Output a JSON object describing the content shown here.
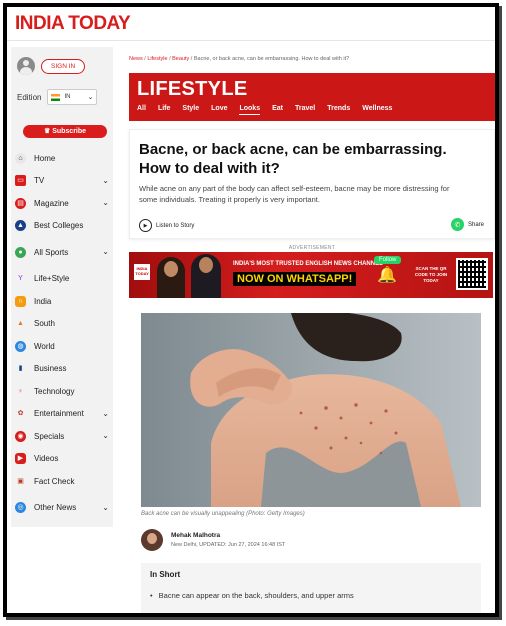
{
  "brand": {
    "logo": "INDIA TODAY",
    "accent": "#d91c1c"
  },
  "sidebar": {
    "signin_label": "SIGN IN",
    "edition_label": "Edition",
    "edition_value": "IN",
    "subscribe_label": "Subscribe",
    "items": [
      {
        "label": "Home",
        "icon": "home-icon",
        "chevron": false
      },
      {
        "label": "TV",
        "icon": "tv-icon",
        "chevron": true
      },
      {
        "label": "Magazine",
        "icon": "magazine-icon",
        "chevron": true
      },
      {
        "label": "Best Colleges",
        "icon": "graduation-cap-icon",
        "chevron": false
      },
      {
        "label": "All Sports",
        "icon": "sports-icon",
        "chevron": true
      },
      {
        "label": "Life+Style",
        "icon": "cocktail-icon",
        "chevron": false
      },
      {
        "label": "India",
        "icon": "india-icon",
        "chevron": false
      },
      {
        "label": "South",
        "icon": "temple-icon",
        "chevron": false
      },
      {
        "label": "World",
        "icon": "globe-icon",
        "chevron": false
      },
      {
        "label": "Business",
        "icon": "chart-icon",
        "chevron": false
      },
      {
        "label": "Technology",
        "icon": "bulb-icon",
        "chevron": false
      },
      {
        "label": "Entertainment",
        "icon": "film-icon",
        "chevron": true
      },
      {
        "label": "Specials",
        "icon": "specials-icon",
        "chevron": true
      },
      {
        "label": "Videos",
        "icon": "video-icon",
        "chevron": false
      },
      {
        "label": "Fact Check",
        "icon": "fact-check-icon",
        "chevron": false
      },
      {
        "label": "Other News",
        "icon": "other-news-icon",
        "chevron": true
      }
    ]
  },
  "breadcrumb": {
    "news": "News",
    "sep": "/",
    "lifestyle": "Lifestyle",
    "beauty": "Beauty",
    "current": "Bacne, or back acne, can be embarrassing. How to deal with it?"
  },
  "section": {
    "title": "LIFESTYLE",
    "tabs": [
      "All",
      "Life",
      "Style",
      "Love",
      "Looks",
      "Eat",
      "Travel",
      "Trends",
      "Wellness"
    ],
    "active_tab": "Looks"
  },
  "article": {
    "headline": "Bacne, or back acne, can be embarrassing. How to deal with it?",
    "dek": "While acne on any part of the body can affect self-esteem, bacne may be more distressing for some individuals. Treating it properly is very important.",
    "listen_label": "Listen to Story",
    "share_label": "Share",
    "caption": "Back acne can be visually unappealing (Photo: Getty Images)",
    "author_name": "Mehak Malhotra",
    "author_meta": "New Delhi, UPDATED: Jun 27, 2024 16:48 IST",
    "inshort_title": "In Short",
    "inshort_bullets": [
      "Bacne can appear on the back, shoulders, and upper arms"
    ]
  },
  "ad": {
    "label": "ADVERTISEMENT",
    "line1": "INDIA'S MOST TRUSTED ENGLISH NEWS CHANNEL",
    "line2": "NOW ON WHATSAPP!",
    "follow": "Follow",
    "scan": "SCAN THE QR CODE TO JOIN TODAY",
    "logo": "INDIA TODAY"
  }
}
